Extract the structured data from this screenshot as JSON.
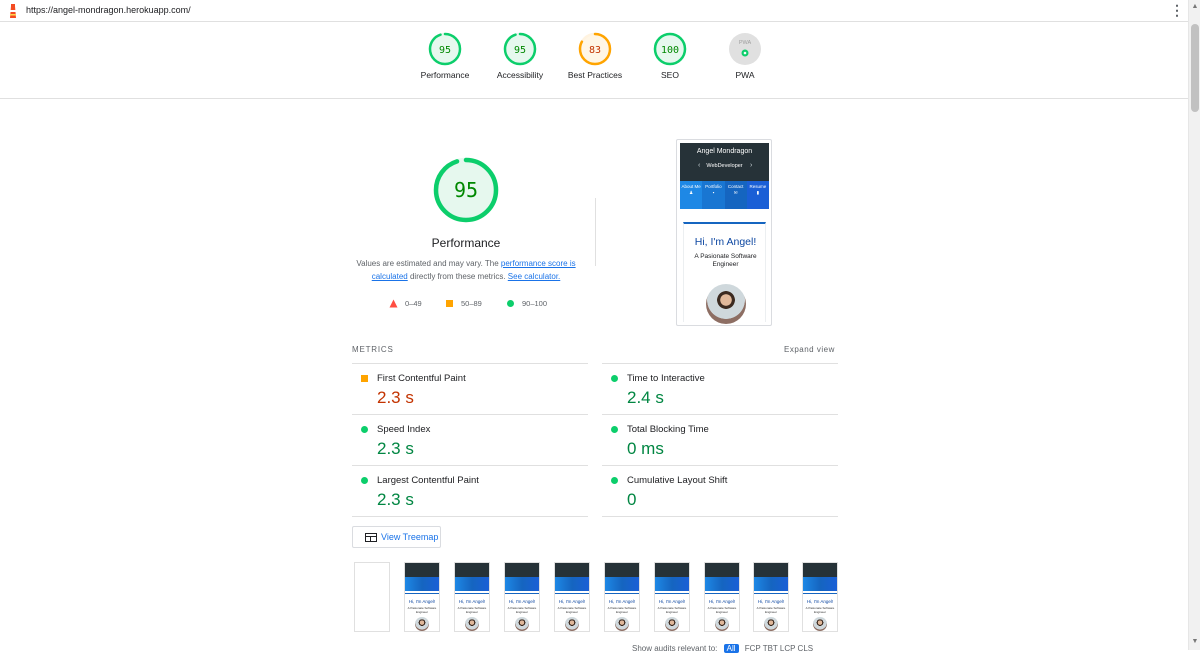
{
  "browser": {
    "url": "https://angel-mondragon.herokuapp.com/",
    "menu_glyph": "⋮"
  },
  "colors": {
    "good": "#0cce6b",
    "average": "#ffa400",
    "fail": "#ff4e42",
    "link": "#1a73e8"
  },
  "summary": {
    "categories": [
      {
        "score": "95",
        "label": "Performance",
        "fraction": 0.95,
        "status": "good"
      },
      {
        "score": "95",
        "label": "Accessibility",
        "fraction": 0.95,
        "status": "good"
      },
      {
        "score": "83",
        "label": "Best Practices",
        "fraction": 0.83,
        "status": "average"
      },
      {
        "score": "100",
        "label": "SEO",
        "fraction": 1.0,
        "status": "good"
      },
      {
        "score": "PWA",
        "label": "PWA",
        "status": "na"
      }
    ]
  },
  "performance": {
    "score": "95",
    "fraction": 0.95,
    "title": "Performance",
    "desc_pre": "Values are estimated and may vary. The ",
    "desc_link1": "performance score is calculated",
    "desc_mid": " directly from these metrics. ",
    "desc_link2": "See calculator.",
    "legend": [
      {
        "shape": "triangle",
        "range": "0–49"
      },
      {
        "shape": "square",
        "range": "50–89"
      },
      {
        "shape": "circle",
        "range": "90–100"
      }
    ]
  },
  "screenshot": {
    "name": "Angel Mondragon",
    "subtitle": "WebDeveloper",
    "tabs": [
      "About Me",
      "Portfolio",
      "Contact",
      "Resume"
    ],
    "greeting": "Hi, I'm Angel!",
    "role": "A Pasionate Software Engineer"
  },
  "metrics": {
    "label": "METRICS",
    "expand": "Expand view",
    "items": [
      {
        "name": "First Contentful Paint",
        "value": "2.3 s",
        "status": "average"
      },
      {
        "name": "Time to Interactive",
        "value": "2.4 s",
        "status": "good"
      },
      {
        "name": "Speed Index",
        "value": "2.3 s",
        "status": "good"
      },
      {
        "name": "Total Blocking Time",
        "value": "0 ms",
        "status": "good"
      },
      {
        "name": "Largest Contentful Paint",
        "value": "2.3 s",
        "status": "good"
      },
      {
        "name": "Cumulative Layout Shift",
        "value": "0",
        "status": "good"
      }
    ]
  },
  "treemap": {
    "label": "View Treemap"
  },
  "filmstrip": {
    "frame_greeting": "Hi, I'm Angel!",
    "frame_role": "A Pasionate Software Engineer"
  },
  "audit_filter": {
    "text": "Show audits relevant to:",
    "options": [
      "All",
      "FCP",
      "TBT",
      "LCP",
      "CLS"
    ]
  }
}
